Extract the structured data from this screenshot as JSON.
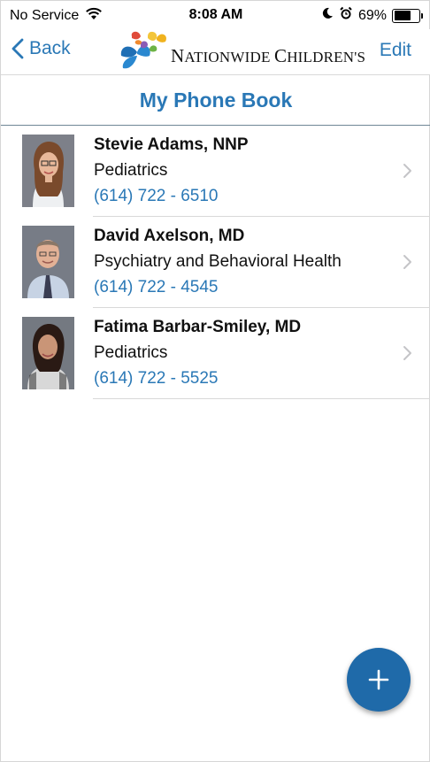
{
  "status_bar": {
    "carrier": "No Service",
    "time": "8:08 AM",
    "battery_text": "69%",
    "battery_level": 0.69,
    "icons": [
      "wifi-icon",
      "moon-icon",
      "alarm-icon",
      "battery-icon"
    ]
  },
  "nav": {
    "back_label": "Back",
    "edit_label": "Edit",
    "logo": {
      "text_first_letter": "N",
      "text_rest": "ATIONWIDE ",
      "text_second_letter": "C",
      "text_end": "HILDREN'S"
    }
  },
  "page": {
    "title": "My Phone Book"
  },
  "contacts": [
    {
      "name": "Stevie Adams, NNP",
      "department": "Pediatrics",
      "phone": "(614) 722 - 6510"
    },
    {
      "name": "David Axelson, MD",
      "department": "Psychiatry and Behavioral Health",
      "phone": "(614) 722 - 4545"
    },
    {
      "name": "Fatima Barbar-Smiley, MD",
      "department": "Pediatrics",
      "phone": "(614) 722 - 5525"
    }
  ],
  "fab": {
    "icon": "plus-icon"
  },
  "colors": {
    "accent": "#2a78b6",
    "fab": "#1f6aa9",
    "divider": "#d9d9d9",
    "chevron": "#c4c4c7"
  }
}
